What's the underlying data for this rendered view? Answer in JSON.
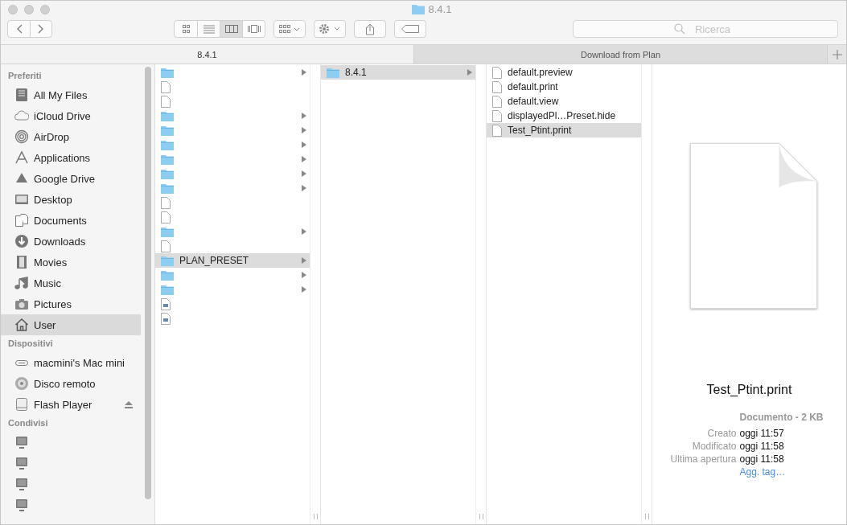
{
  "window": {
    "title": "8.4.1"
  },
  "toolbar": {
    "view_buttons": [
      {
        "selected": false
      },
      {
        "selected": false
      },
      {
        "selected": true
      },
      {
        "selected": false
      }
    ],
    "search": {
      "placeholder": "Ricerca"
    }
  },
  "tabs": [
    {
      "label": "8.4.1",
      "selected": true
    },
    {
      "label": "Download from Plan",
      "selected": false
    }
  ],
  "sidebar": {
    "sections": [
      {
        "title": "Preferiti",
        "items": [
          {
            "label": "All My Files",
            "selected": false
          },
          {
            "label": "iCloud Drive",
            "selected": false
          },
          {
            "label": "AirDrop",
            "selected": false
          },
          {
            "label": "Applications",
            "selected": false
          },
          {
            "label": "Google Drive",
            "selected": false
          },
          {
            "label": "Desktop",
            "selected": false
          },
          {
            "label": "Documents",
            "selected": false
          },
          {
            "label": "Downloads",
            "selected": false
          },
          {
            "label": "Movies",
            "selected": false
          },
          {
            "label": "Music",
            "selected": false
          },
          {
            "label": "Pictures",
            "selected": false
          },
          {
            "label": "User",
            "selected": true
          }
        ]
      },
      {
        "title": "Dispositivi",
        "items": [
          {
            "label": "macmini's Mac mini",
            "selected": false
          },
          {
            "label": "Disco remoto",
            "selected": false
          },
          {
            "label": "Flash Player",
            "selected": false,
            "ejectable": true
          }
        ]
      },
      {
        "title": "Condivisi",
        "items": [
          {
            "selected": false
          },
          {
            "selected": false
          },
          {
            "selected": false
          },
          {
            "selected": false
          }
        ]
      }
    ]
  },
  "columns": [
    {
      "items": [
        {
          "kind": "folder",
          "has_children": true,
          "selected": false
        },
        {
          "kind": "file",
          "has_children": false,
          "selected": false
        },
        {
          "kind": "file",
          "has_children": false,
          "selected": false
        },
        {
          "kind": "folder",
          "has_children": true,
          "selected": false
        },
        {
          "kind": "folder",
          "has_children": true,
          "selected": false
        },
        {
          "kind": "folder",
          "has_children": true,
          "selected": false
        },
        {
          "kind": "folder",
          "has_children": true,
          "selected": false
        },
        {
          "kind": "folder",
          "has_children": true,
          "selected": false
        },
        {
          "kind": "folder",
          "has_children": true,
          "selected": false
        },
        {
          "kind": "file",
          "has_children": false,
          "selected": false
        },
        {
          "kind": "file",
          "has_children": false,
          "selected": false
        },
        {
          "kind": "folder",
          "has_children": true,
          "selected": false
        },
        {
          "kind": "file",
          "has_children": false,
          "selected": false
        },
        {
          "kind": "folder",
          "name": "PLAN_PRESET",
          "has_children": true,
          "selected": true
        },
        {
          "kind": "folder",
          "has_children": true,
          "selected": false
        },
        {
          "kind": "folder",
          "has_children": true,
          "selected": false
        },
        {
          "kind": "image",
          "has_children": false,
          "selected": false
        },
        {
          "kind": "image",
          "has_children": false,
          "selected": false
        }
      ]
    },
    {
      "items": [
        {
          "kind": "folder",
          "name": "8.4.1",
          "has_children": true,
          "selected": true
        }
      ]
    },
    {
      "items": [
        {
          "kind": "file",
          "name": "default.preview",
          "has_children": false,
          "selected": false
        },
        {
          "kind": "file",
          "name": "default.print",
          "has_children": false,
          "selected": false
        },
        {
          "kind": "file",
          "name": "default.view",
          "has_children": false,
          "selected": false
        },
        {
          "kind": "file",
          "name": "displayedPl…Preset.hide",
          "has_children": false,
          "selected": false
        },
        {
          "kind": "file",
          "name": "Test_Ptint.print",
          "has_children": false,
          "selected": true
        }
      ]
    }
  ],
  "preview": {
    "filename": "Test_Ptint.print",
    "kind": "Documento - 2 KB",
    "info": [
      {
        "label": "Creato",
        "value": "oggi 11:57"
      },
      {
        "label": "Modificato",
        "value": "oggi 11:58"
      },
      {
        "label": "Ultima apertura",
        "value": "oggi 11:58"
      }
    ],
    "tag_link": "Agg. tag…"
  }
}
